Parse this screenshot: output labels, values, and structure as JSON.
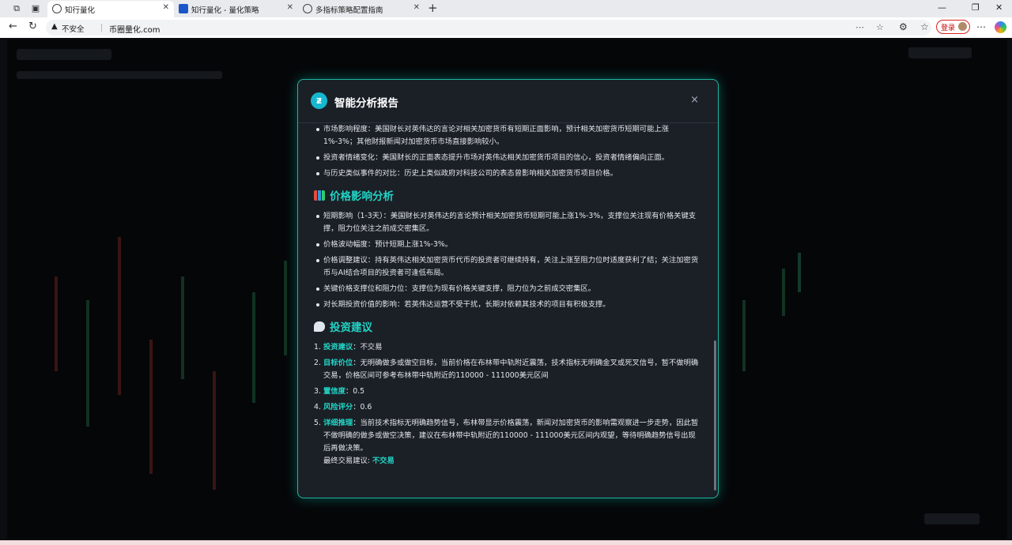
{
  "browser": {
    "tabs": [
      {
        "title": "知行量化",
        "active": true
      },
      {
        "title": "知行量化 - 量化策略",
        "active": false
      },
      {
        "title": "多指标策略配置指南",
        "active": false
      }
    ],
    "address": {
      "security_label": "不安全",
      "url": "币圈量化.com"
    },
    "login_label": "登录"
  },
  "modal": {
    "title": "智能分析报告",
    "close_glyph": "×",
    "intro_items": [
      "市场影响程度：美国财长对英伟达的言论对相关加密货币有短期正面影响，预计相关加密货币短期可能上涨1%-3%；其他财报新闻对加密货币市场直接影响较小。",
      "投资者情绪变化：美国财长的正面表态提升市场对英伟达相关加密货币项目的信心，投资者情绪偏向正面。",
      "与历史类似事件的对比：历史上类似政府对科技公司的表态曾影响相关加密货币项目价格。"
    ],
    "price_section": {
      "heading": "价格影响分析",
      "items": [
        "短期影响（1-3天）：美国财长对英伟达的言论预计相关加密货币短期可能上涨1%-3%，支撑位关注现有价格关键支撑，阻力位关注之前成交密集区。",
        "价格波动幅度：预计短期上涨1%-3%。",
        "价格调整建议：持有英伟达相关加密货币代币的投资者可继续持有，关注上涨至阻力位时适度获利了结；关注加密货币与AI结合项目的投资者可逢低布局。",
        "关键价格支撑位和阻力位：支撑位为现有价格关键支撑，阻力位为之前成交密集区。",
        "对长期投资价值的影响：若英伟达运营不受干扰，长期对依赖其技术的项目有积极支撑。"
      ]
    },
    "advice_section": {
      "heading": "投资建议",
      "items": [
        {
          "num": "1.",
          "label": "投资建议",
          "text": "：不交易"
        },
        {
          "num": "2.",
          "label": "目标价位",
          "text": "：无明确做多或做空目标，当前价格在布林带中轨附近震荡，技术指标无明确金叉或死叉信号，暂不做明确交易，价格区间可参考布林带中轨附近的110000 - 111000美元区间"
        },
        {
          "num": "3.",
          "label": "置信度",
          "text": "：0.5"
        },
        {
          "num": "4.",
          "label": "风险评分",
          "text": "：0.6"
        },
        {
          "num": "5.",
          "label": "详细推理",
          "text": "：当前技术指标无明确趋势信号，布林带显示价格震荡，新闻对加密货币的影响需观察进一步走势，因此暂不做明确的做多或做空决策，建议在布林带中轨附近的110000 - 111000美元区间内观望，等待明确趋势信号出现后再做决策。"
        }
      ],
      "final_label": "最终交易建议: ",
      "final_value": "不交易"
    }
  },
  "colors": {
    "accent": "#22d3c5",
    "modal_bg": "#1b2027",
    "modal_border": "#1fb5a0",
    "page_bg": "#050608"
  }
}
